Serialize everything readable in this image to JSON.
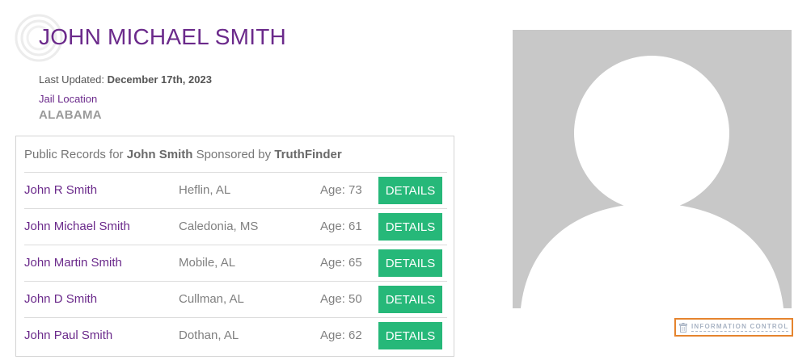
{
  "person": {
    "name": "JOHN MICHAEL SMITH",
    "last_updated_label": "Last Updated:",
    "last_updated_date": "December 17th, 2023",
    "jail_location_label": "Jail Location",
    "state": "ALABAMA"
  },
  "records": {
    "prefix": "Public Records for",
    "search_name": "John Smith",
    "sponsored_text": "Sponsored by",
    "sponsor": "TruthFinder",
    "rows": [
      {
        "name": "John R Smith",
        "location": "Heflin, AL",
        "age": "Age: 73",
        "button": "DETAILS"
      },
      {
        "name": "John Michael Smith",
        "location": "Caledonia, MS",
        "age": "Age: 61",
        "button": "DETAILS"
      },
      {
        "name": "John Martin Smith",
        "location": "Mobile, AL",
        "age": "Age: 65",
        "button": "DETAILS"
      },
      {
        "name": "John D Smith",
        "location": "Cullman, AL",
        "age": "Age: 50",
        "button": "DETAILS"
      },
      {
        "name": "John Paul Smith",
        "location": "Dothan, AL",
        "age": "Age: 62",
        "button": "DETAILS"
      }
    ]
  },
  "info_control": {
    "label": "INFORMATION CONTROL",
    "icon": "trash-icon"
  },
  "colors": {
    "brand_purple": "#6b2a8b",
    "details_green": "#26b879",
    "info_control_border": "#e5842e",
    "placeholder_gray": "#c8c8c8"
  }
}
